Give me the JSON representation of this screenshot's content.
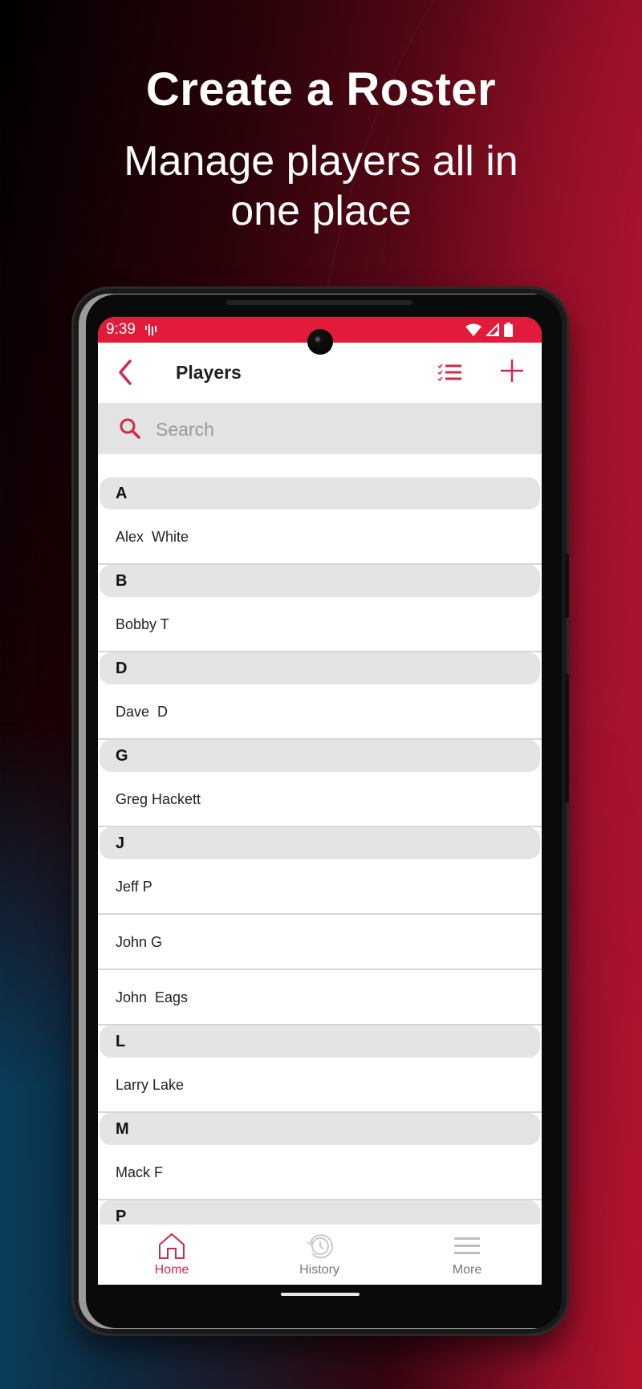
{
  "promo": {
    "title": "Create a Roster",
    "subtitle_line1": "Manage players all in",
    "subtitle_line2": "one place"
  },
  "status_bar": {
    "time": "9:39",
    "icons": [
      "vibrate-icon",
      "wifi-icon",
      "signal-icon",
      "battery-icon"
    ]
  },
  "app_bar": {
    "title": "Players",
    "back_icon": "chevron-left-icon",
    "actions": [
      "checklist-icon",
      "plus-icon"
    ]
  },
  "search": {
    "placeholder": "Search",
    "value": ""
  },
  "roster": [
    {
      "letter": "A",
      "players": [
        "Alex  White"
      ]
    },
    {
      "letter": "B",
      "players": [
        "Bobby T"
      ]
    },
    {
      "letter": "D",
      "players": [
        "Dave  D"
      ]
    },
    {
      "letter": "G",
      "players": [
        "Greg Hackett"
      ]
    },
    {
      "letter": "J",
      "players": [
        "Jeff P",
        "John G",
        "John  Eags"
      ]
    },
    {
      "letter": "L",
      "players": [
        "Larry Lake"
      ]
    },
    {
      "letter": "M",
      "players": [
        "Mack F"
      ]
    },
    {
      "letter": "P",
      "players": []
    }
  ],
  "tabs": [
    {
      "label": "Home",
      "icon": "home-icon",
      "active": true
    },
    {
      "label": "History",
      "icon": "history-icon",
      "active": false
    },
    {
      "label": "More",
      "icon": "menu-icon",
      "active": false
    }
  ],
  "colors": {
    "accent": "#e31b3b",
    "active_tab": "#d4284a",
    "section_bg": "#e4e4e4",
    "search_bg": "#e3e3e3"
  }
}
